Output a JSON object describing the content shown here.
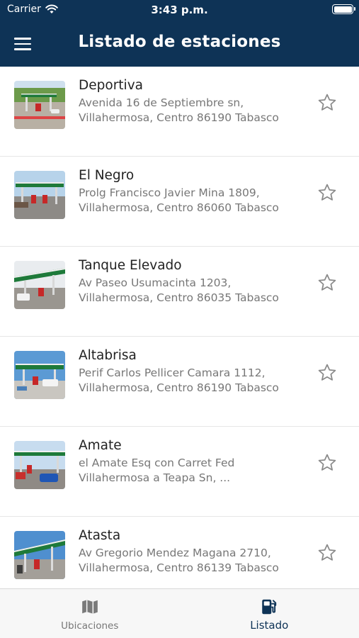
{
  "status_bar": {
    "carrier": "Carrier",
    "time": "3:43 p.m."
  },
  "header": {
    "title": "Listado de estaciones",
    "menu_icon": "hamburger-menu-icon"
  },
  "stations": [
    {
      "name": "Deportiva",
      "address_line1": "Avenida 16 de Septiembre sn,",
      "address_line2": "Villahermosa, Centro 86190 Tabasco"
    },
    {
      "name": "El Negro",
      "address_line1": "Prolg Francisco Javier Mina 1809,",
      "address_line2": "Villahermosa, Centro 86060 Tabasco"
    },
    {
      "name": "Tanque Elevado",
      "address_line1": "Av Paseo Usumacinta 1203,",
      "address_line2": "Villahermosa, Centro 86035 Tabasco"
    },
    {
      "name": "Altabrisa",
      "address_line1": "Perif Carlos Pellicer Camara 1112,",
      "address_line2": "Villahermosa, Centro 86190 Tabasco"
    },
    {
      "name": "Amate",
      "address_line1": "el Amate Esq con Carret Fed",
      "address_line2": "Villahermosa a Teapa Sn, ..."
    },
    {
      "name": "Atasta",
      "address_line1": "Av Gregorio Mendez Magana 2710,",
      "address_line2": "Villahermosa, Centro 86139 Tabasco"
    }
  ],
  "tabbar": {
    "tabs": [
      {
        "label": "Ubicaciones",
        "icon": "map-icon",
        "active": false
      },
      {
        "label": "Listado",
        "icon": "fuel-pump-icon",
        "active": true
      }
    ]
  },
  "colors": {
    "header": "#0e3356",
    "active_tab": "#0e3356",
    "inactive_tab": "#777777",
    "star": "#8a8a8a"
  }
}
